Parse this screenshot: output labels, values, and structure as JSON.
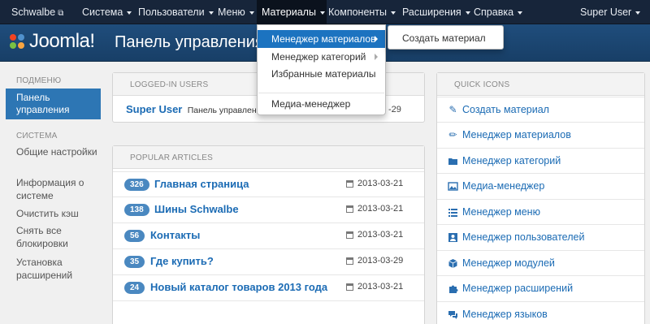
{
  "navbar": {
    "site_name": "Schwalbe",
    "menus": [
      "Система",
      "Пользователи",
      "Меню",
      "Материалы",
      "Компоненты",
      "Расширения",
      "Справка"
    ],
    "user": "Super User"
  },
  "header": {
    "logo_text": "Joomla!",
    "page_title": "Панель управления"
  },
  "sidebar": {
    "submenu_heading": "ПОДМЕНЮ",
    "active_item": "Панель управления",
    "system_heading": "СИСТЕМА",
    "system_items": [
      "Общие настройки",
      "Информация о системе",
      "Очистить кэш",
      "Снять все блокировки",
      "Установка расширений"
    ]
  },
  "logged_in": {
    "heading": "LOGGED-IN USERS",
    "user_name": "Super User",
    "user_location": "Панель управления",
    "date_fragment": "-29"
  },
  "popular": {
    "heading": "POPULAR ARTICLES",
    "articles": [
      {
        "hits": "326",
        "title": "Главная страница",
        "date": "2013-03-21"
      },
      {
        "hits": "138",
        "title": "Шины Schwalbe",
        "date": "2013-03-21"
      },
      {
        "hits": "56",
        "title": "Контакты",
        "date": "2013-03-21"
      },
      {
        "hits": "35",
        "title": "Где купить?",
        "date": "2013-03-29"
      },
      {
        "hits": "24",
        "title": "Новый каталог товаров 2013 года",
        "date": "2013-03-21"
      }
    ]
  },
  "quick_icons": {
    "heading": "QUICK ICONS",
    "items": [
      {
        "label": "Создать материал",
        "icon": "pencil-square-icon"
      },
      {
        "label": "Менеджер материалов",
        "icon": "pencil-icon"
      },
      {
        "label": "Менеджер категорий",
        "icon": "folder-icon"
      },
      {
        "label": "Медиа-менеджер",
        "icon": "image-icon"
      },
      {
        "label": "Менеджер меню",
        "icon": "list-icon"
      },
      {
        "label": "Менеджер пользователей",
        "icon": "user-icon"
      },
      {
        "label": "Менеджер модулей",
        "icon": "cube-icon"
      },
      {
        "label": "Менеджер расширений",
        "icon": "puzzle-icon"
      },
      {
        "label": "Менеджер языков",
        "icon": "comment-icon"
      }
    ]
  },
  "dropdown": {
    "items": [
      "Менеджер материалов",
      "Менеджер категорий",
      "Избранные материалы",
      "Медиа-менеджер"
    ],
    "submenu_item": "Создать материал"
  },
  "colors": {
    "navbar": "#17253a",
    "header": "#1f4d7c",
    "accent": "#2d76b4",
    "link": "#1b6bb4",
    "badge": "#4a88c0"
  }
}
